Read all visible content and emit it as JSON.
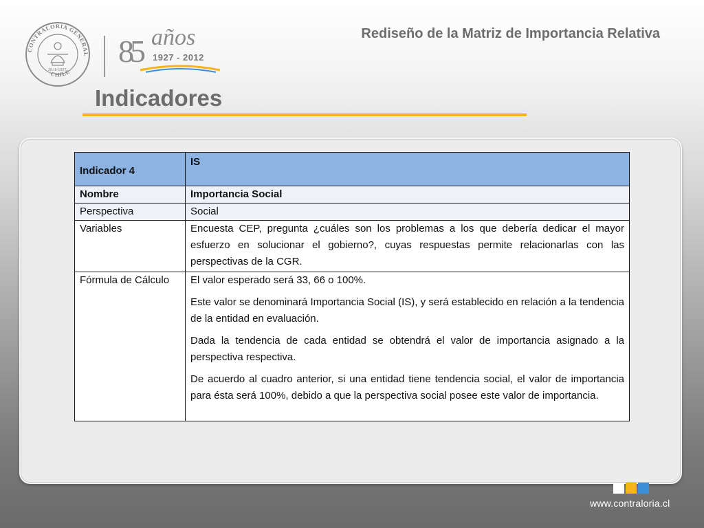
{
  "header": {
    "title": "Rediseño de la Matriz de Importancia Relativa",
    "slide_title": "Indicadores"
  },
  "logo": {
    "seal_text": "CONTRALORIA GENERAL DE LA REPUBLICA",
    "seal_bottom": "CHILE",
    "seal_date": "26-III-1927",
    "anniversary_number": "85",
    "anniversary_word": "años",
    "anniversary_years": "1927 - 2012"
  },
  "table": {
    "header": {
      "label": "Indicador  4",
      "value": "IS"
    },
    "rows": [
      {
        "label": "Nombre",
        "value": "Importancia Social"
      },
      {
        "label": "Perspectiva",
        "value": "Social"
      },
      {
        "label": "Variables",
        "value": "Encuesta CEP, pregunta ¿cuáles son los problemas a los que debería dedicar el mayor esfuerzo en solucionar el gobierno?, cuyas respuestas permite relacionarlas con las perspectivas de la CGR."
      }
    ],
    "formula": {
      "label": "Fórmula de Cálculo",
      "paragraphs": [
        "El valor esperado será 33, 66 o 100%.",
        "Este valor se denominará Importancia Social (IS), y será establecido en relación a la tendencia de la entidad en evaluación.",
        "Dada la tendencia de cada entidad se obtendrá el valor de importancia asignado a la perspectiva respectiva.",
        "De acuerdo al cuadro anterior, si una entidad tiene tendencia social, el valor de importancia para ésta será 100%, debido a que la perspectiva social posee este valor de importancia."
      ]
    }
  },
  "footer": {
    "url": "www.contraloria.cl",
    "square_colors": [
      "#ffffff",
      "#f5b418",
      "#3a8fd6"
    ]
  },
  "colors": {
    "accent": "#f5b418",
    "header_fill": "#8db3e2"
  }
}
